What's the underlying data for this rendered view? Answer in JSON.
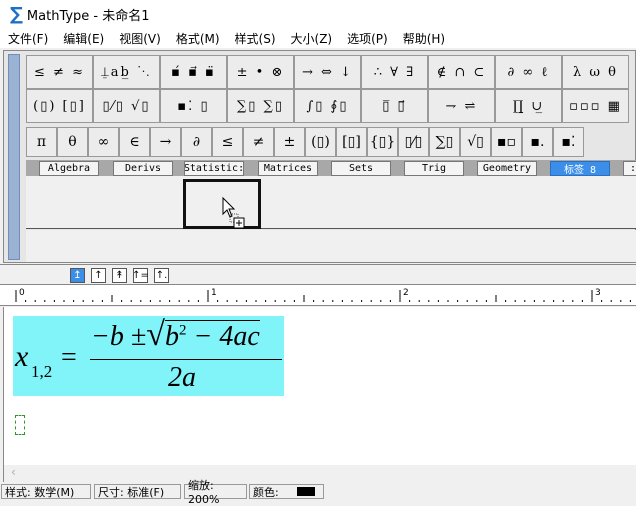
{
  "window": {
    "title": "MathType - 未命名1",
    "icon": "sigma-logo-icon"
  },
  "menu": [
    "文件(F)",
    "编辑(E)",
    "视图(V)",
    "格式(M)",
    "样式(S)",
    "大小(Z)",
    "选项(P)",
    "帮助(H)"
  ],
  "toolbar": {
    "row1": [
      "≤ ≠ ≈",
      "⍊ab̲ ⋱",
      "▪́ ▪⃗ ▪̈",
      "± • ⊗",
      "→ ⇔ ↓",
      "∴ ∀ ∃",
      "∉ ∩ ⊂",
      "∂ ∞ ℓ",
      "λ ω θ"
    ],
    "row2": [
      "(▯) [▯]",
      "▯⁄▯ √▯",
      "▪⁚ ▯",
      "∑▯ ∑▯",
      "∫▯ ∮▯",
      "▯̅ ▯⃗",
      "⇁ ⇌",
      "∏̲ ∪̲",
      "▫▫▫ ▦"
    ],
    "row3": [
      "π",
      "θ",
      "∞",
      "∈",
      "→",
      "∂",
      "≤",
      "≠",
      "±",
      "(▯)",
      "[▯]",
      "{▯}",
      "▯⁄▯",
      "∑▯",
      "√▯",
      "▪▫",
      "▪.",
      "▪⁚"
    ]
  },
  "tabs": [
    {
      "label": "Algebra"
    },
    {
      "label": "Derivs"
    },
    {
      "label": "Statistic:"
    },
    {
      "label": "Matrices"
    },
    {
      "label": "Sets"
    },
    {
      "label": "Trig"
    },
    {
      "label": "Geometry"
    },
    {
      "label": "标签 8",
      "active": true
    },
    {
      "label": ":"
    }
  ],
  "style_buttons": [
    "↥",
    "↑",
    "↟",
    "↑=",
    "↑."
  ],
  "ruler": {
    "labels": [
      "0",
      "1",
      "2",
      "3"
    ]
  },
  "equation": {
    "lhs": "x",
    "sub": "1,2",
    "eq": "=",
    "num_pre": "−b ±",
    "rad_base": "b",
    "rad_exp": "2",
    "rad_rest": " − 4ac",
    "den": "2a"
  },
  "scrollbar": {
    "left": "‹"
  },
  "status": {
    "style": "样式: 数学(M)",
    "size": "尺寸: 标准(F)",
    "zoom": "缩放: 200%",
    "color_label": "颜色:",
    "color": "#000000"
  }
}
